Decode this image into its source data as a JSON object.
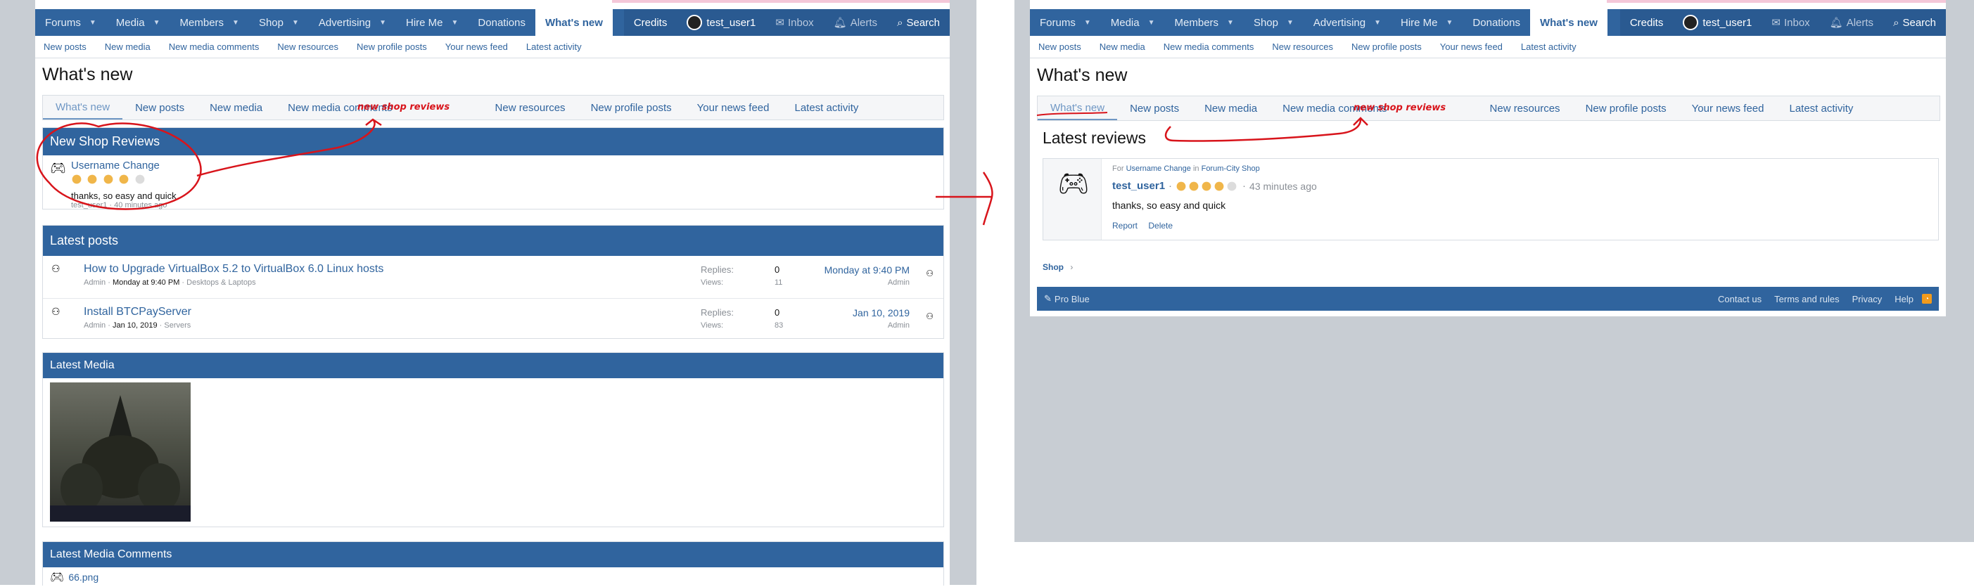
{
  "nav": {
    "items": [
      "Forums",
      "Media",
      "Members",
      "Shop",
      "Advertising",
      "Hire Me"
    ],
    "donations": "Donations",
    "whats_new": "What's new",
    "credits": "Credits",
    "user": "test_user1",
    "inbox": "Inbox",
    "alerts": "Alerts",
    "search": "Search"
  },
  "subnav": [
    "New posts",
    "New media",
    "New media comments",
    "New resources",
    "New profile posts",
    "Your news feed",
    "Latest activity"
  ],
  "left": {
    "title": "What's new",
    "tabs": [
      "What's new",
      "New posts",
      "New media",
      "New media comments",
      "New resources",
      "New profile posts",
      "Your news feed",
      "Latest activity"
    ],
    "scribble_label": "new shop reviews",
    "shop_reviews": {
      "heading": "New Shop Reviews",
      "item_title": "Username Change",
      "rating": 4,
      "text": "thanks, so easy and quick",
      "meta_user": "test_user1",
      "meta_time": "40 minutes ago"
    },
    "latest_posts": {
      "heading": "Latest posts",
      "rows": [
        {
          "title": "How to Upgrade VirtualBox 5.2 to VirtualBox 6.0 Linux hosts",
          "author": "Admin",
          "date": "Monday at 9:40 PM",
          "forum": "Desktops & Laptops",
          "replies_label": "Replies:",
          "replies": "0",
          "views_label": "Views:",
          "views": "11",
          "last_date": "Monday at 9:40 PM",
          "last_user": "Admin"
        },
        {
          "title": "Install BTCPayServer",
          "author": "Admin",
          "date": "Jan 10, 2019",
          "forum": "Servers",
          "replies_label": "Replies:",
          "replies": "0",
          "views_label": "Views:",
          "views": "83",
          "last_date": "Jan 10, 2019",
          "last_user": "Admin"
        }
      ]
    },
    "latest_media": {
      "heading": "Latest Media"
    },
    "latest_media_comments": {
      "heading": "Latest Media Comments",
      "item": "66.png"
    }
  },
  "right": {
    "title": "What's new",
    "tabs": [
      "What's new",
      "New posts",
      "New media",
      "New media comments",
      "New resources",
      "New profile posts",
      "Your news feed",
      "Latest activity"
    ],
    "scribble_label": "new shop reviews",
    "section_title": "Latest reviews",
    "review": {
      "for_label": "For",
      "item": "Username Change",
      "in_label": "in",
      "shop": "Forum-City Shop",
      "user": "test_user1",
      "rating": 4,
      "time": "43 minutes ago",
      "text": "thanks, so easy and quick",
      "report": "Report",
      "delete": "Delete"
    },
    "breadcrumb": "Shop",
    "footer": {
      "style": "Pro Blue",
      "links": [
        "Contact us",
        "Terms and rules",
        "Privacy",
        "Help"
      ]
    }
  },
  "colors": {
    "nav": "#30649e",
    "annotation": "#d8141b",
    "star": "#f0b64a"
  }
}
